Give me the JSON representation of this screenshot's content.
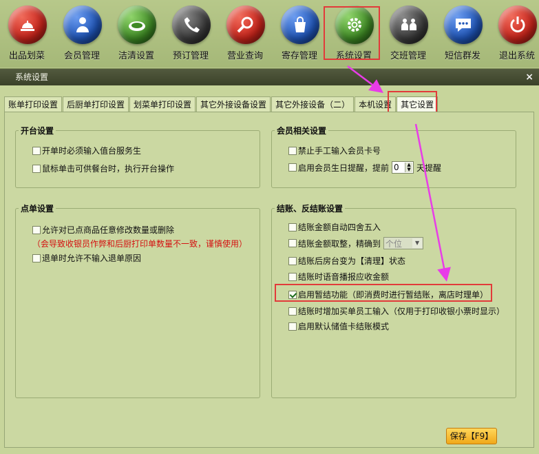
{
  "toolbar": [
    {
      "label": "出品划菜",
      "icon": "bell-icon",
      "color": "#c8241b"
    },
    {
      "label": "会员管理",
      "icon": "person-icon",
      "color": "#1f55b8"
    },
    {
      "label": "洁清设置",
      "icon": "plate-icon",
      "color": "#3e8a24"
    },
    {
      "label": "预订管理",
      "icon": "phone-icon",
      "color": "#3a3a3a"
    },
    {
      "label": "营业查询",
      "icon": "magnifier-icon",
      "color": "#c8241b"
    },
    {
      "label": "寄存管理",
      "icon": "bag-icon",
      "color": "#1f55b8"
    },
    {
      "label": "系统设置",
      "icon": "gear-icon",
      "color": "#3e8a24"
    },
    {
      "label": "交班管理",
      "icon": "handover-icon",
      "color": "#3a3a3a"
    },
    {
      "label": "短信群发",
      "icon": "message-icon",
      "color": "#1f55b8"
    },
    {
      "label": "退出系统",
      "icon": "power-icon",
      "color": "#c8241b"
    }
  ],
  "window": {
    "title": "系统设置",
    "close": "×"
  },
  "tabs": [
    "账单打印设置",
    "后厨单打印设置",
    "划菜单打印设置",
    "其它外接设备设置",
    "其它外接设备（二）",
    "本机设置",
    "其它设置"
  ],
  "groups": {
    "open_table": {
      "title": "开台设置",
      "items": [
        "开单时必须输入值台服务生",
        "鼠标单击可供餐台时，执行开台操作"
      ]
    },
    "member": {
      "title": "会员相关设置",
      "item1": "禁止手工输入会员卡号",
      "item2_prefix": "启用会员生日提醒，提前",
      "item2_value": "0",
      "item2_suffix": "天提醒"
    },
    "order": {
      "title": "点单设置",
      "item1": "允许对已点商品任意修改数量或删除",
      "warning": "（会导致收银员作弊和后厨打印单数量不一致，谨慎使用）",
      "item2": "退单时允许不输入退单原因"
    },
    "checkout": {
      "title": "结账、反结账设置",
      "item1": "结账金额自动四舍五入",
      "item2_prefix": "结账金额取整，精确到",
      "item2_select": "个位",
      "item3": "结账后房台变为【清理】状态",
      "item4": "结账时语音播报应收金额",
      "item5": "启用暂结功能（即消费时进行暂结账，离店时理单）",
      "item6": "结账时增加买单员工输入（仅用于打印收银小票时显示）",
      "item7": "启用默认储值卡结账模式"
    }
  },
  "save_label": "保存【F9】"
}
